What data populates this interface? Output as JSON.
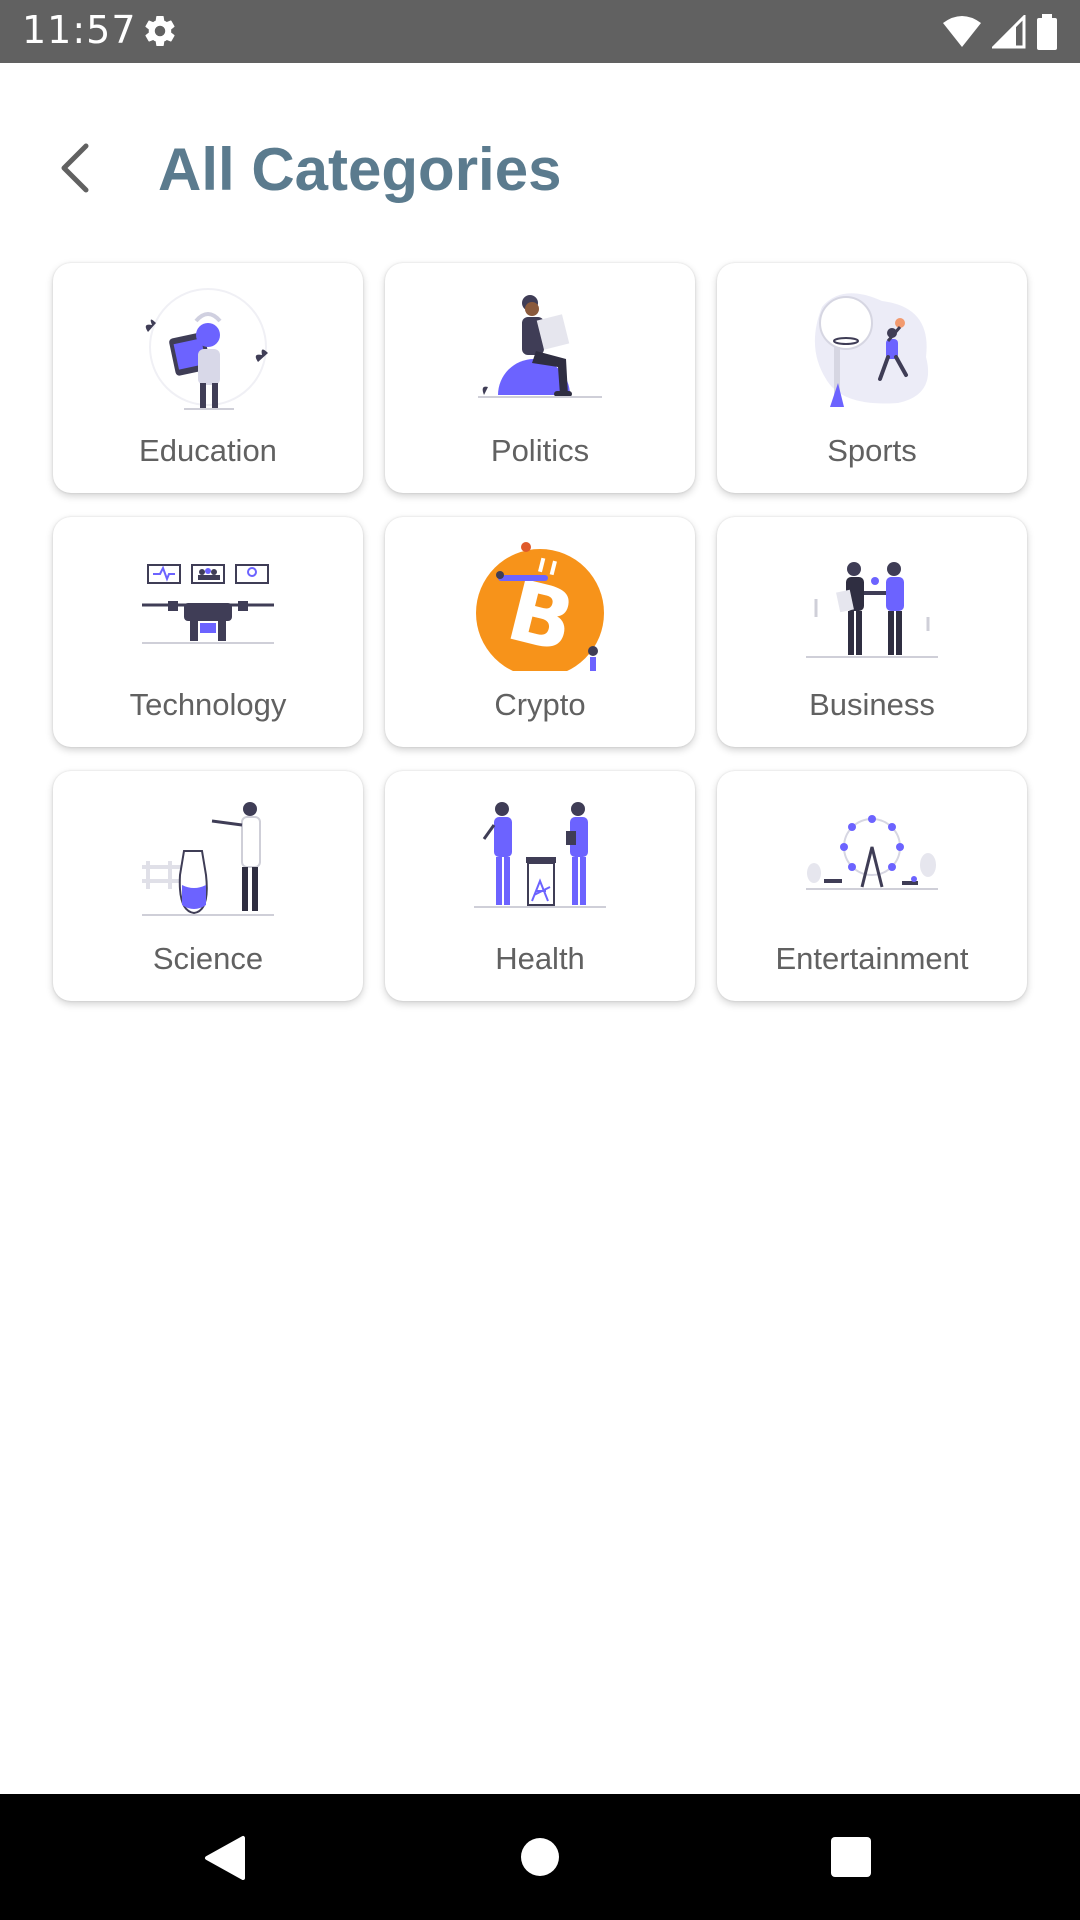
{
  "status_bar": {
    "time": "11:57"
  },
  "header": {
    "title": "All Categories"
  },
  "categories": [
    {
      "label": "Education",
      "icon": "education-illustration"
    },
    {
      "label": "Politics",
      "icon": "politics-illustration"
    },
    {
      "label": "Sports",
      "icon": "sports-illustration"
    },
    {
      "label": "Technology",
      "icon": "technology-illustration"
    },
    {
      "label": "Crypto",
      "icon": "crypto-illustration"
    },
    {
      "label": "Business",
      "icon": "business-illustration"
    },
    {
      "label": "Science",
      "icon": "science-illustration"
    },
    {
      "label": "Health",
      "icon": "health-illustration"
    },
    {
      "label": "Entertainment",
      "icon": "entertainment-illustration"
    }
  ],
  "colors": {
    "title": "#5b7b8e",
    "accent": "#6c63ff",
    "bitcoin": "#f7931a",
    "status_bar": "#616161",
    "nav_bar": "#000000"
  }
}
